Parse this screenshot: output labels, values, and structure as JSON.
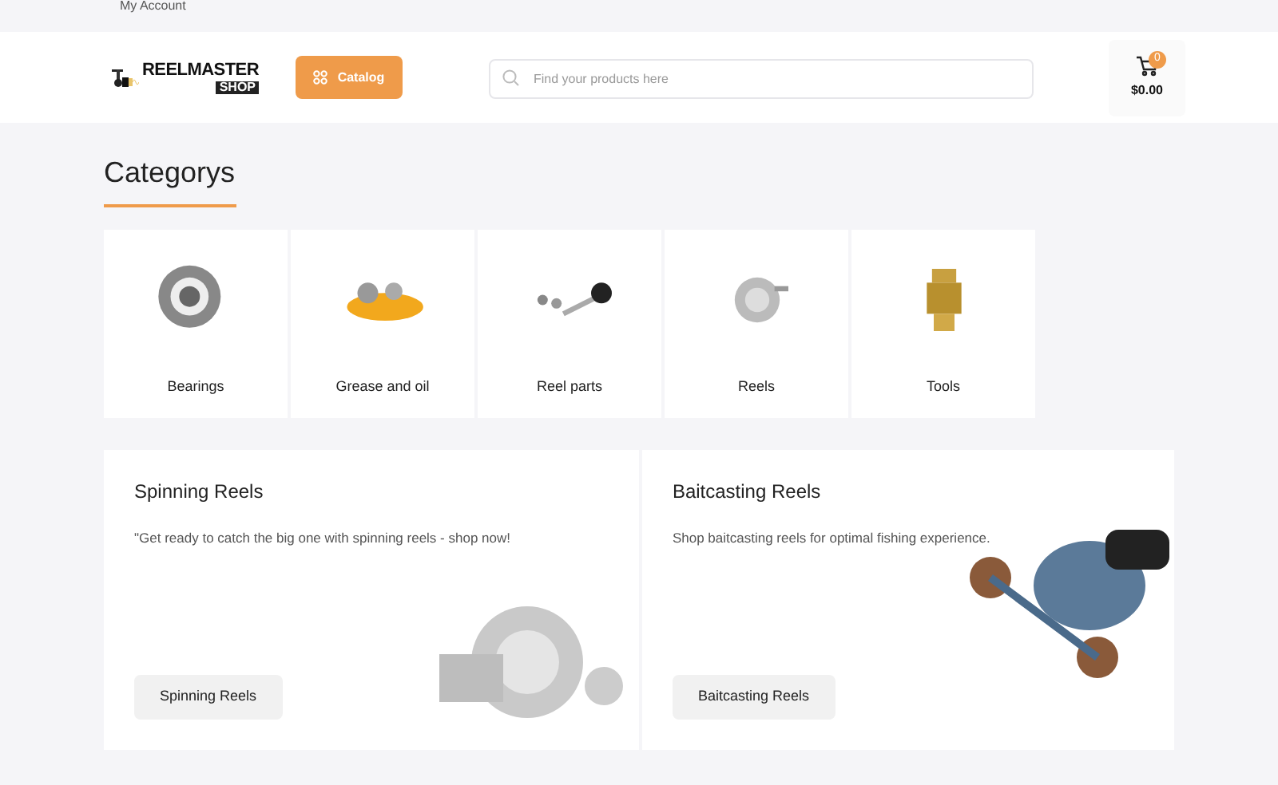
{
  "top_bar": {
    "link": "My Account"
  },
  "header": {
    "logo": {
      "title": "REELMASTER",
      "subtitle": "SHOP"
    },
    "catalog_button": "Catalog",
    "search": {
      "placeholder": "Find your products here"
    },
    "cart": {
      "count": "0",
      "total": "$0.00"
    }
  },
  "categories": {
    "title": "Categorys",
    "items": [
      {
        "label": "Bearings"
      },
      {
        "label": "Grease and oil"
      },
      {
        "label": "Reel parts"
      },
      {
        "label": "Reels"
      },
      {
        "label": "Tools"
      }
    ]
  },
  "promos": [
    {
      "title": "Spinning Reels",
      "text": "\"Get ready to catch the big one with spinning reels - shop now!",
      "button": "Spinning Reels"
    },
    {
      "title": "Baitcasting Reels",
      "text": "Shop baitcasting reels for optimal fishing experience.",
      "button": "Baitcasting Reels"
    }
  ]
}
